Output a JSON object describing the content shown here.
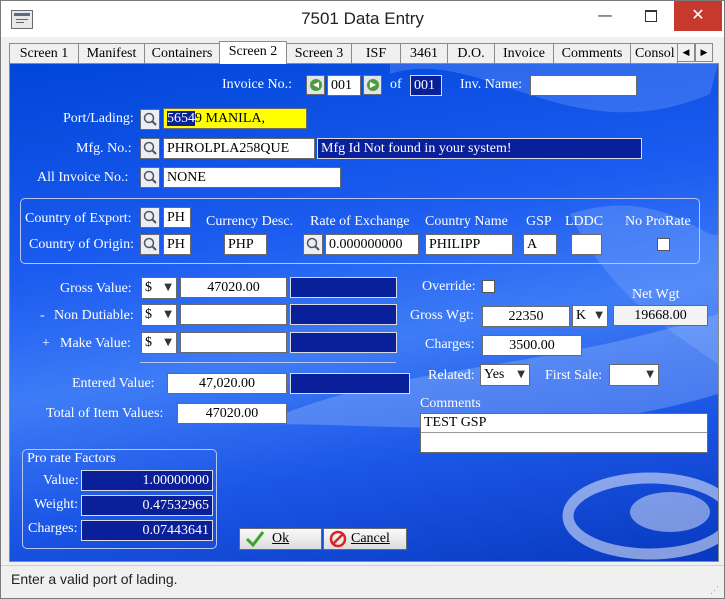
{
  "window": {
    "title": "7501 Data Entry",
    "minimize": "—",
    "close": "✕"
  },
  "tabs": [
    "Screen 1",
    "Manifest",
    "Containers",
    "Screen 2",
    "Screen 3",
    "ISF",
    "3461",
    "D.O.",
    "Invoice",
    "Comments",
    "Consol"
  ],
  "active_tab": "Screen 2",
  "tab_scroll": {
    "left": "◀",
    "right": "▶"
  },
  "invoice": {
    "label": "Invoice No.:",
    "current": "001",
    "of_label": "of",
    "total": "001",
    "name_label": "Inv. Name:",
    "name_value": ""
  },
  "port_lading": {
    "label": "Port/Lading:",
    "code_selected": "5654",
    "code_rest": "9",
    "value_rest": " MANILA,"
  },
  "mfg": {
    "label": "Mfg. No.:",
    "value": "PHROLPLA258QUE",
    "message": "Mfg Id Not found in your system!"
  },
  "all_invoice": {
    "label": "All Invoice No.:",
    "value": "NONE"
  },
  "country_export": {
    "label": "Country of Export:",
    "value": "PH"
  },
  "country_origin": {
    "label": "Country of Origin:",
    "value": "PH"
  },
  "currency": {
    "label": "Currency Desc.",
    "value": "PHP"
  },
  "exchange": {
    "label": "Rate of Exchange",
    "value": "0.000000000"
  },
  "country_name": {
    "label": "Country Name",
    "value": "PHILIPP"
  },
  "gsp": {
    "label": "GSP",
    "value": "A"
  },
  "lddc": {
    "label": "LDDC",
    "value": ""
  },
  "no_prorate": {
    "label": "No ProRate",
    "checked": false
  },
  "gross_value": {
    "label": "Gross Value:",
    "currency": "$",
    "value": "47020.00",
    "extra": ""
  },
  "non_dutiable": {
    "prefix": "-",
    "label": "Non Dutiable:",
    "currency": "$",
    "value": "",
    "extra": ""
  },
  "make_value": {
    "prefix": "+",
    "label": "Make Value:",
    "currency": "$",
    "value": "",
    "extra": ""
  },
  "entered_value": {
    "label": "Entered Value:",
    "value": "47,020.00",
    "extra": ""
  },
  "total_items": {
    "label": "Total of Item Values:",
    "value": "47020.00"
  },
  "override": {
    "label": "Override:",
    "checked": false
  },
  "net_wgt": {
    "label": "Net Wgt",
    "value": "19668.00"
  },
  "gross_wgt": {
    "label": "Gross Wgt:",
    "value": "22350",
    "unit": "K"
  },
  "charges": {
    "label": "Charges:",
    "value": "3500.00"
  },
  "related": {
    "label": "Related:",
    "value": "Yes"
  },
  "first_sale": {
    "label": "First Sale:",
    "value": ""
  },
  "comments": {
    "label": "Comments",
    "line1": "TEST GSP",
    "line2": ""
  },
  "prorate": {
    "title": "Pro rate Factors",
    "value_label": "Value:",
    "value": "1.00000000",
    "weight_label": "Weight:",
    "weight": "0.47532965",
    "charges_label": "Charges:",
    "charges": "0.07443641"
  },
  "buttons": {
    "ok": "Ok",
    "cancel": "Cancel"
  },
  "status": "Enter a valid port of lading.",
  "colors": {
    "panel_blue": "#1c5cf0",
    "field_navy": "#0a1f9a",
    "highlight_yellow": "#ffff00",
    "close_red": "#c7392e"
  }
}
